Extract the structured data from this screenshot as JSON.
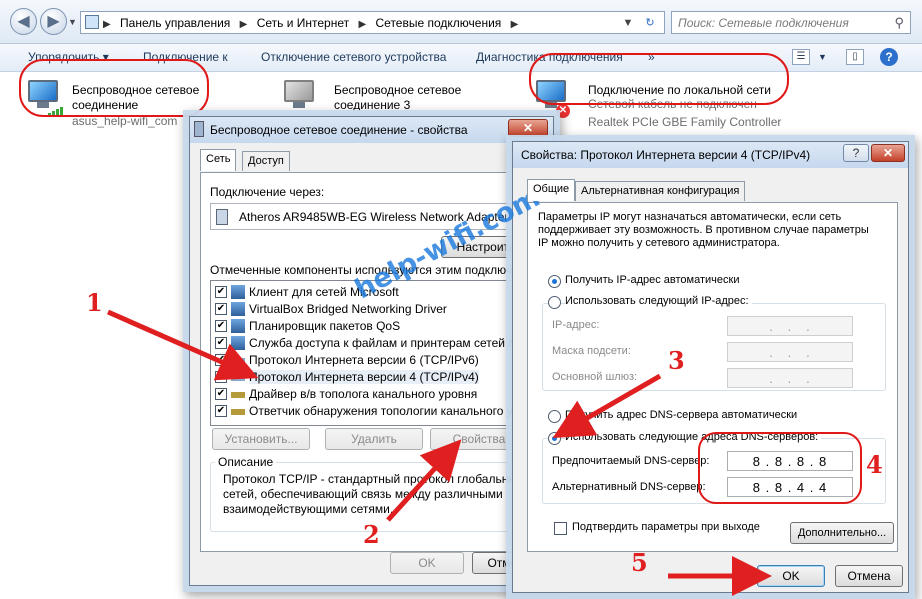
{
  "explorer": {
    "breadcrumbs": [
      "Панель управления",
      "Сеть и Интернет",
      "Сетевые подключения"
    ],
    "search_placeholder": "Поиск: Сетевые подключения",
    "commands": [
      "Упорядочить",
      "Подключение к",
      "Отключение сетевого устройства",
      "Диагностика подключения",
      "»"
    ],
    "connections": [
      {
        "name_line1": "Беспроводное сетевое",
        "name_line2": "соединение",
        "sub": "asus_help-wifi_com"
      },
      {
        "name_line1": "Беспроводное сетевое",
        "name_line2": "соединение 3",
        "sub": ""
      },
      {
        "name_line1": "Подключение по локальной сети",
        "sub1": "Сетевой кабель не подключен",
        "sub2": "Realtek PCIe GBE Family Controller"
      }
    ]
  },
  "props_dialog": {
    "title": "Беспроводное сетевое соединение - свойства",
    "tabs": [
      "Сеть",
      "Доступ"
    ],
    "connect_using_label": "Подключение через:",
    "adapter_name": "Atheros AR9485WB-EG Wireless Network Adapter",
    "configure_button": "Настроить...",
    "components_label": "Отмеченные компоненты используются этим подключением:",
    "components": [
      {
        "label": "Клиент для сетей Microsoft",
        "checked": true
      },
      {
        "label": "VirtualBox Bridged Networking Driver",
        "checked": true
      },
      {
        "label": "Планировщик пакетов QoS",
        "checked": true
      },
      {
        "label": "Служба доступа к файлам и принтерам сетей Microsoft",
        "checked": true
      },
      {
        "label": "Протокол Интернета версии 6 (TCP/IPv6)",
        "checked": true
      },
      {
        "label": "Протокол Интернета версии 4 (TCP/IPv4)",
        "checked": true
      },
      {
        "label": "Драйвер в/в тополога канального уровня",
        "checked": true
      },
      {
        "label": "Ответчик обнаружения топологии канального уровня",
        "checked": true
      }
    ],
    "install_button": "Установить...",
    "remove_button": "Удалить",
    "properties_button": "Свойства",
    "description_title": "Описание",
    "description_lines": [
      "Протокол TCP/IP - стандартный протокол глобальных",
      "сетей, обеспечивающий связь между различными",
      "взаимодействующими сетями."
    ],
    "ok_button": "OK",
    "cancel_button": "Отмена"
  },
  "ipv4_dialog": {
    "title": "Свойства: Протокол Интернета версии 4 (TCP/IPv4)",
    "help_button": "?",
    "tabs": [
      "Общие",
      "Альтернативная конфигурация"
    ],
    "intro_lines": [
      "Параметры IP могут назначаться автоматически, если сеть",
      "поддерживает эту возможность. В противном случае параметры",
      "IP можно получить у сетевого администратора."
    ],
    "auto_ip_label": "Получить IP-адрес автоматически",
    "manual_ip_label": "Использовать следующий IP-адрес:",
    "ip_address_label": "IP-адрес:",
    "subnet_label": "Маска подсети:",
    "gateway_label": "Основной шлюз:",
    "empty_ip": " .   .   . ",
    "auto_dns_label": "Получить адрес DNS-сервера автоматически",
    "manual_dns_label": "Использовать следующие адреса DNS-серверов:",
    "preferred_dns_label": "Предпочитаемый DNS-сервер:",
    "preferred_dns": "8 . 8 . 8 . 8",
    "alternate_dns_label": "Альтернативный DNS-сервер:",
    "alternate_dns": "8 . 8 . 4 . 4",
    "validate_label": "Подтвердить параметры при выходе",
    "advanced_button": "Дополнительно...",
    "ok_button": "OK",
    "cancel_button": "Отмена",
    "selected": {
      "ip_mode": "auto",
      "dns_mode": "manual"
    }
  },
  "annotations": {
    "numbers": [
      "1",
      "2",
      "3",
      "4",
      "5"
    ],
    "watermark": "help-wifi.com",
    "color": "#e02020"
  }
}
